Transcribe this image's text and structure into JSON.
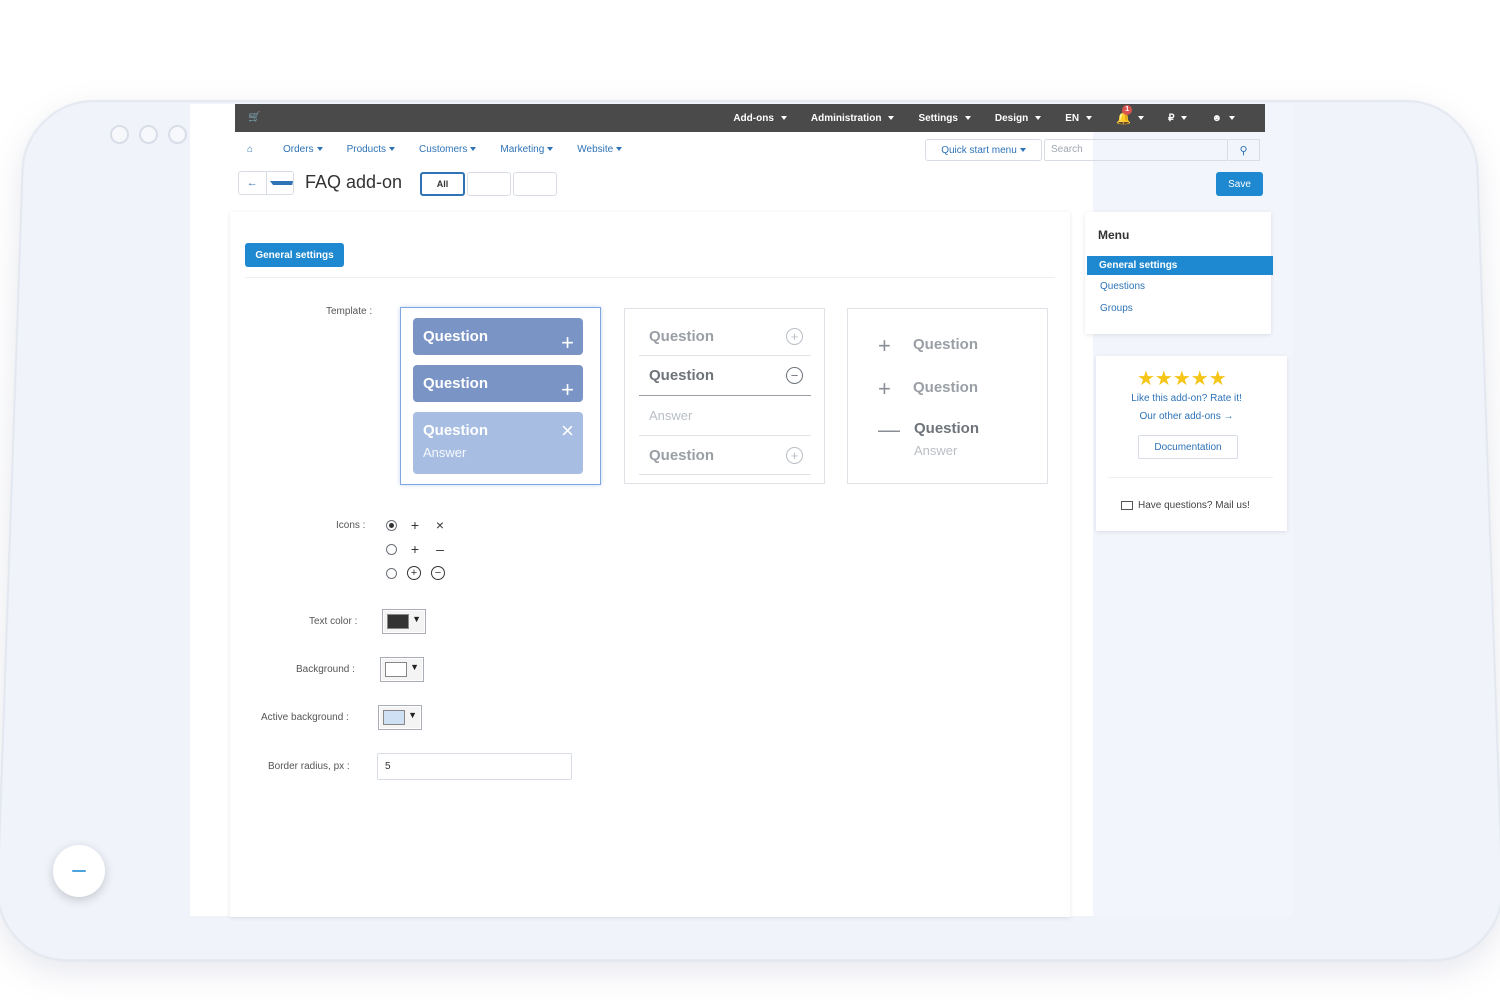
{
  "topbar": {
    "menu": [
      "Add-ons",
      "Administration",
      "Settings",
      "Design",
      "EN"
    ],
    "notifications_count": "1",
    "currency": "₽"
  },
  "nav": {
    "items": [
      "Orders",
      "Products",
      "Customers",
      "Marketing",
      "Website"
    ],
    "quick_start": "Quick start menu",
    "search_placeholder": "Search"
  },
  "title": {
    "page_title": "FAQ add-on",
    "storefront_all": "All",
    "save": "Save"
  },
  "tabs": {
    "general": "General settings"
  },
  "form": {
    "template_label": "Template :",
    "icons_label": "Icons :",
    "text_color_label": "Text color :",
    "background_label": "Background :",
    "active_background_label": "Active background :",
    "border_radius_label": "Border radius, px :",
    "border_radius_value": "5",
    "text_color": "#333333",
    "background_color": "#ffffff",
    "active_background_color": "#cfe0f5",
    "selected_icon_set": 0
  },
  "templates": {
    "t1": {
      "q1": "Question",
      "q2": "Question",
      "q3": "Question",
      "a": "Answer",
      "color_dark": "#7a95c5",
      "color_light": "#a7bde2"
    },
    "t2": {
      "q1": "Question",
      "q2": "Question",
      "a": "Answer",
      "q3": "Question"
    },
    "t3": {
      "q1": "Question",
      "q2": "Question",
      "q3": "Question",
      "a": "Answer"
    }
  },
  "sidebar": {
    "menu_title": "Menu",
    "items": [
      "General settings",
      "Questions",
      "Groups"
    ],
    "rate_text": "Like this add-on? Rate it!",
    "other_addons": "Our other add-ons →",
    "documentation": "Documentation",
    "mail": "Have questions? Mail us!",
    "stars": "★★★★★"
  },
  "colors": {
    "accent": "#1e88d0",
    "link": "#2e73b6",
    "topbar": "#4a4a4a",
    "star": "#f5c518"
  }
}
